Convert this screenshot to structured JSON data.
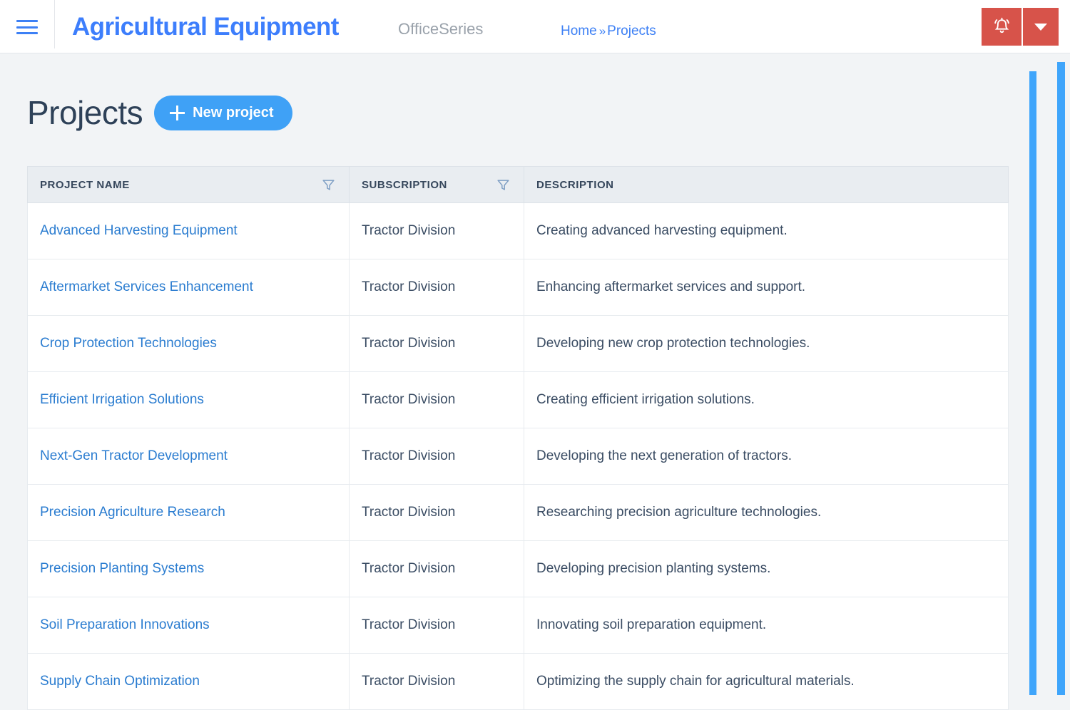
{
  "header": {
    "menu_icon": "hamburger-icon",
    "brand_title": "Agricultural Equipment",
    "brand_subtitle": "OfficeSeries",
    "breadcrumb": {
      "home": "Home",
      "separator": "»",
      "current": "Projects"
    },
    "notification_icon": "bell-ringing-icon",
    "notification_caret_icon": "chevron-down-icon",
    "notification_color": "#d7534a",
    "brand_color": "#3d7efc"
  },
  "page": {
    "title": "Projects",
    "new_project_label": "New project",
    "new_project_icon": "plus-icon",
    "accent_color": "#3fa1f6"
  },
  "table": {
    "columns": [
      {
        "label": "Project Name",
        "filterable": true,
        "filter_icon": "filter-funnel-icon"
      },
      {
        "label": "Subscription",
        "filterable": true,
        "filter_icon": "filter-funnel-icon"
      },
      {
        "label": "Description",
        "filterable": false,
        "filter_icon": ""
      }
    ],
    "rows": [
      {
        "name": "Advanced Harvesting Equipment",
        "subscription": "Tractor Division",
        "description": "Creating advanced harvesting equipment."
      },
      {
        "name": "Aftermarket Services Enhancement",
        "subscription": "Tractor Division",
        "description": "Enhancing aftermarket services and support."
      },
      {
        "name": "Crop Protection Technologies",
        "subscription": "Tractor Division",
        "description": "Developing new crop protection technologies."
      },
      {
        "name": "Efficient Irrigation Solutions",
        "subscription": "Tractor Division",
        "description": "Creating efficient irrigation solutions."
      },
      {
        "name": "Next-Gen Tractor Development",
        "subscription": "Tractor Division",
        "description": "Developing the next generation of tractors."
      },
      {
        "name": "Precision Agriculture Research",
        "subscription": "Tractor Division",
        "description": "Researching precision agriculture technologies."
      },
      {
        "name": "Precision Planting Systems",
        "subscription": "Tractor Division",
        "description": "Developing precision planting systems."
      },
      {
        "name": "Soil Preparation Innovations",
        "subscription": "Tractor Division",
        "description": "Innovating soil preparation equipment."
      },
      {
        "name": "Supply Chain Optimization",
        "subscription": "Tractor Division",
        "description": "Optimizing the supply chain for agricultural materials."
      }
    ]
  },
  "scrollbars": {
    "inner_color": "#3fa5fb",
    "outer_color": "#3fa5fb"
  }
}
